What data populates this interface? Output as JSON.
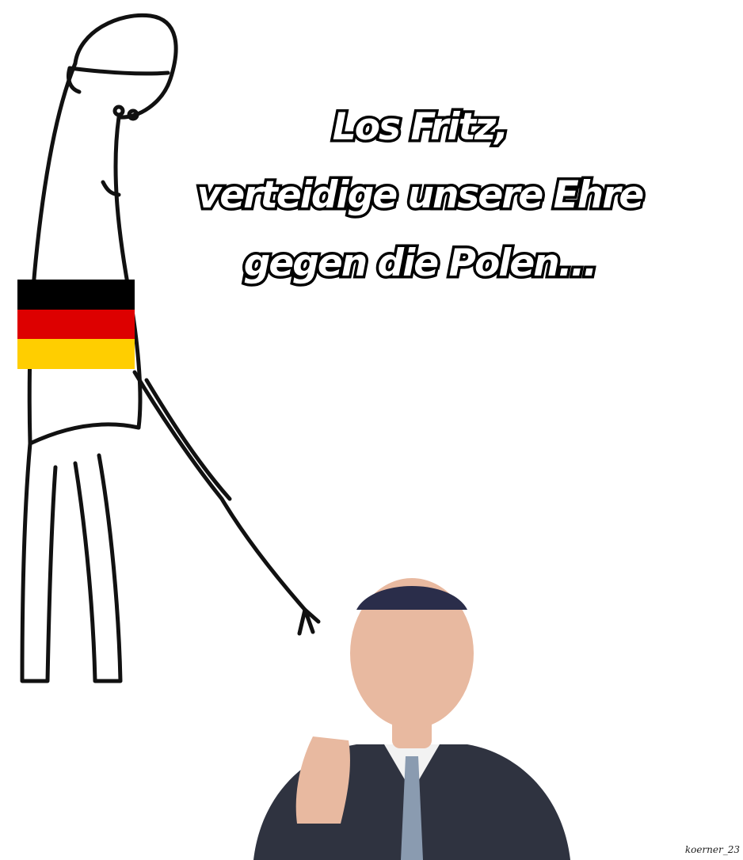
{
  "caption": {
    "lines": [
      "Los Fritz,",
      "verteidige unsere Ehre",
      "gegen die Polen..."
    ]
  },
  "flag": {
    "stripes": [
      "#000000",
      "#dd0000",
      "#ffce00"
    ]
  },
  "signature": "koerner_23",
  "colors": {
    "background": "#ffffff",
    "line_art": "#111111",
    "suit": "#2f3340",
    "shirt": "#f2f2f2",
    "skin": "#e8b9a0"
  }
}
